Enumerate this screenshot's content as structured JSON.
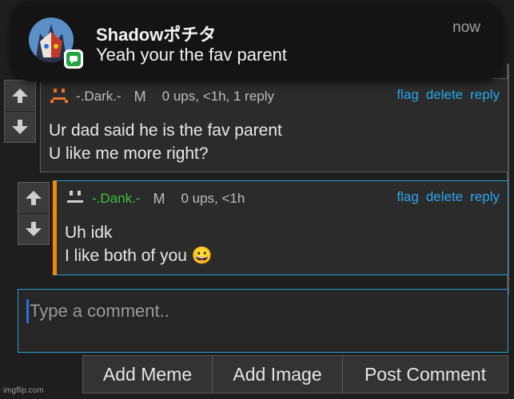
{
  "notification": {
    "title": "Shadowポチタ",
    "message": "Yeah your the fav parent",
    "time": "now"
  },
  "comments": [
    {
      "username": "-.Dark.-",
      "badge": "M",
      "stats": "0 ups, <1h, 1 reply",
      "actions": [
        "flag",
        "delete",
        "reply"
      ],
      "lines": [
        "Ur dad said he is the fav parent",
        "U like me more right?"
      ],
      "avatar_color": "#e8722a"
    },
    {
      "username": "-.Dank.-",
      "badge": "M",
      "stats": "0 ups, <1h",
      "actions": [
        "flag",
        "delete",
        "reply"
      ],
      "lines": [
        "Uh idk",
        "I like both of you"
      ],
      "emoji": "😀",
      "avatar_color": "#cfcfcf"
    }
  ],
  "comment_box": {
    "placeholder": "Type a comment.."
  },
  "buttons": {
    "add_meme": "Add Meme",
    "add_image": "Add Image",
    "post_comment": "Post Comment"
  },
  "watermark": "imgflip.com",
  "colors": {
    "link": "#2aa6e8",
    "accent": "#f08a00",
    "focus": "#2a9bd6",
    "green_name": "#3fbf3f"
  }
}
